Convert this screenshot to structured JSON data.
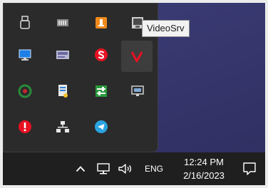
{
  "tooltip": {
    "text": "VideoSrv"
  },
  "tray_overflow": {
    "icons": [
      "usb-drive-icon",
      "gpu-memory-icon",
      "orange-app-icon",
      "video-server-icon",
      "monitor-icon",
      "hardware-card-icon",
      "red-s-icon",
      "red-v-icon",
      "green-circle-icon",
      "printer-document-icon",
      "green-sliders-icon",
      "display-settings-icon",
      "red-alert-icon",
      "network-tree-icon",
      "telegram-icon"
    ],
    "hovered": "red-v-icon"
  },
  "taskbar": {
    "language": "ENG",
    "time": "12:24 PM",
    "date": "2/16/2023",
    "icons": [
      "chevron-up-icon",
      "network-icon",
      "volume-icon",
      "notification-icon"
    ]
  },
  "colors": {
    "panel": "#2b2b2b",
    "taskbar": "#1f1f1f",
    "desktop": "#3a3a6c",
    "alert_red": "#e81123",
    "orange": "#f08a1c",
    "telegram": "#2aa3e0"
  }
}
